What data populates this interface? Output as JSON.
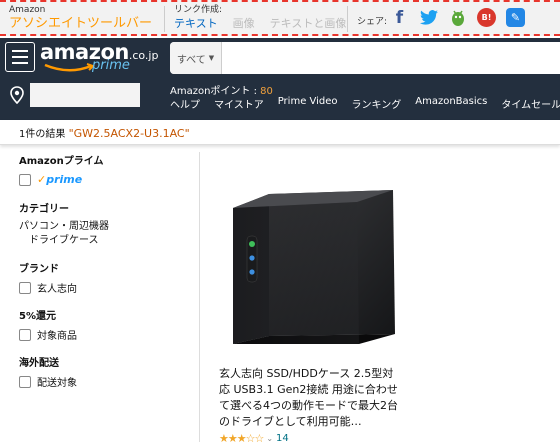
{
  "associate_bar": {
    "brand_small": "Amazon",
    "brand_title": "アソシエイトツールバー",
    "link_label": "リンク作成:",
    "link_options": [
      {
        "label": "テキスト",
        "active": true
      },
      {
        "label": "画像",
        "active": false
      },
      {
        "label": "テキストと画像",
        "active": false
      }
    ],
    "share_label": "シェア:",
    "share_icons": [
      "facebook-icon",
      "twitter-icon",
      "feedly-icon",
      "hatena-icon",
      "pen-icon"
    ],
    "accent_color": "#e8352c"
  },
  "header": {
    "logo_word": "amazon",
    "logo_tld": ".co.jp",
    "logo_prime": "prime",
    "search_dept": "すべて",
    "points_label": "Amazonポイント : ",
    "points_value": "80",
    "nav_links": [
      "ヘルプ",
      "マイストア",
      "Prime Video",
      "ランキング",
      "AmazonBasics",
      "タイムセール"
    ],
    "bg_color": "#232f3e"
  },
  "results": {
    "count_text": "1件の結果",
    "query": "\"GW2.5ACX2-U3.1AC\""
  },
  "sidebar": {
    "prime_heading": "Amazonプライム",
    "prime_badge": "prime",
    "category_heading": "カテゴリー",
    "category_parent": "パソコン・周辺機器",
    "category_child": "ドライブケース",
    "brand_heading": "ブランド",
    "brand_option": "玄人志向",
    "discount_heading": "5%還元",
    "discount_option": "対象商品",
    "overseas_heading": "海外配送",
    "overseas_option": "配送対象"
  },
  "product": {
    "title": "玄人志向 SSD/HDDケース 2.5型対応 USB3.1 Gen2接続 用途に合わせて選べる4つの動作モードで最大2台のドライブとして利用可能…",
    "rating": 3.5,
    "review_count": "14"
  }
}
